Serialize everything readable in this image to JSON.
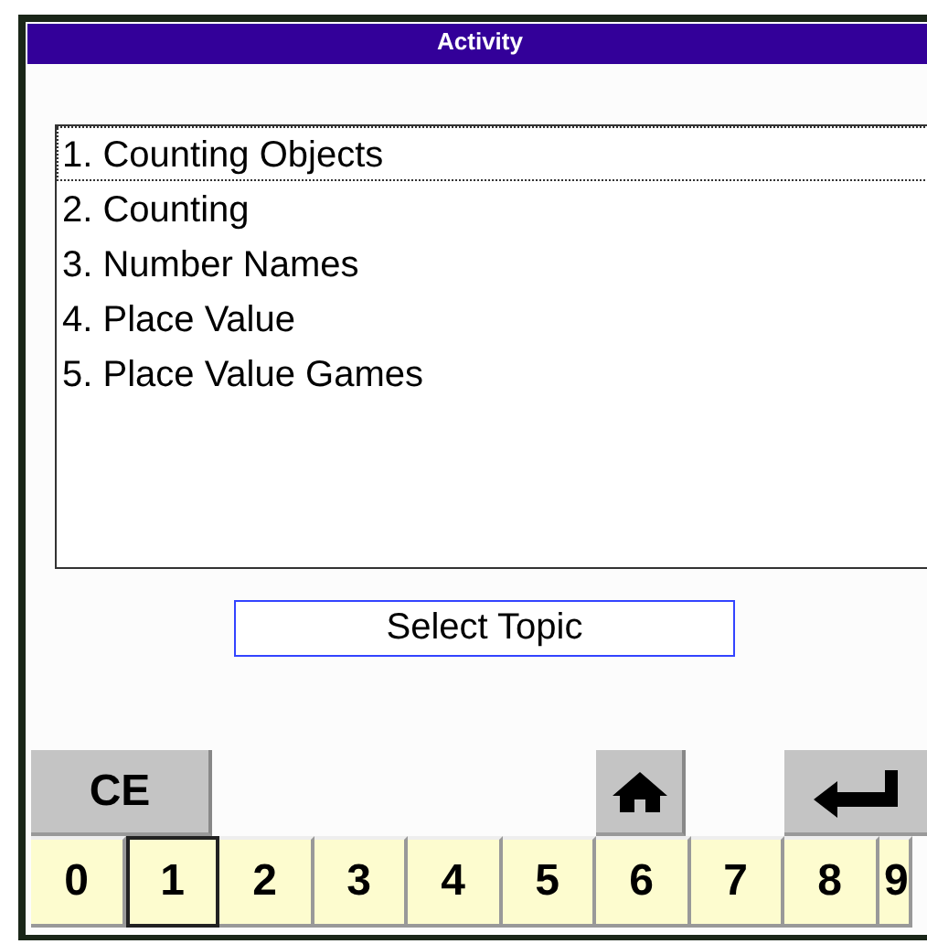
{
  "window": {
    "title": "Activity"
  },
  "topics": [
    {
      "label": "1. Counting Objects",
      "selected": true
    },
    {
      "label": "2. Counting",
      "selected": false
    },
    {
      "label": "3. Number Names",
      "selected": false
    },
    {
      "label": "4. Place Value",
      "selected": false
    },
    {
      "label": "5. Place Value Games",
      "selected": false
    }
  ],
  "prompt": "Select Topic",
  "function_keys": [
    {
      "kind": "clear",
      "label": "CE"
    },
    {
      "kind": "home"
    },
    {
      "kind": "enter"
    }
  ],
  "digit_keys": [
    {
      "label": "0",
      "selected": false
    },
    {
      "label": "1",
      "selected": true
    },
    {
      "label": "2",
      "selected": false
    },
    {
      "label": "3",
      "selected": false
    },
    {
      "label": "4",
      "selected": false
    },
    {
      "label": "5",
      "selected": false
    },
    {
      "label": "6",
      "selected": false
    },
    {
      "label": "7",
      "selected": false
    },
    {
      "label": "8",
      "selected": false
    },
    {
      "label": "9",
      "selected": false
    }
  ]
}
